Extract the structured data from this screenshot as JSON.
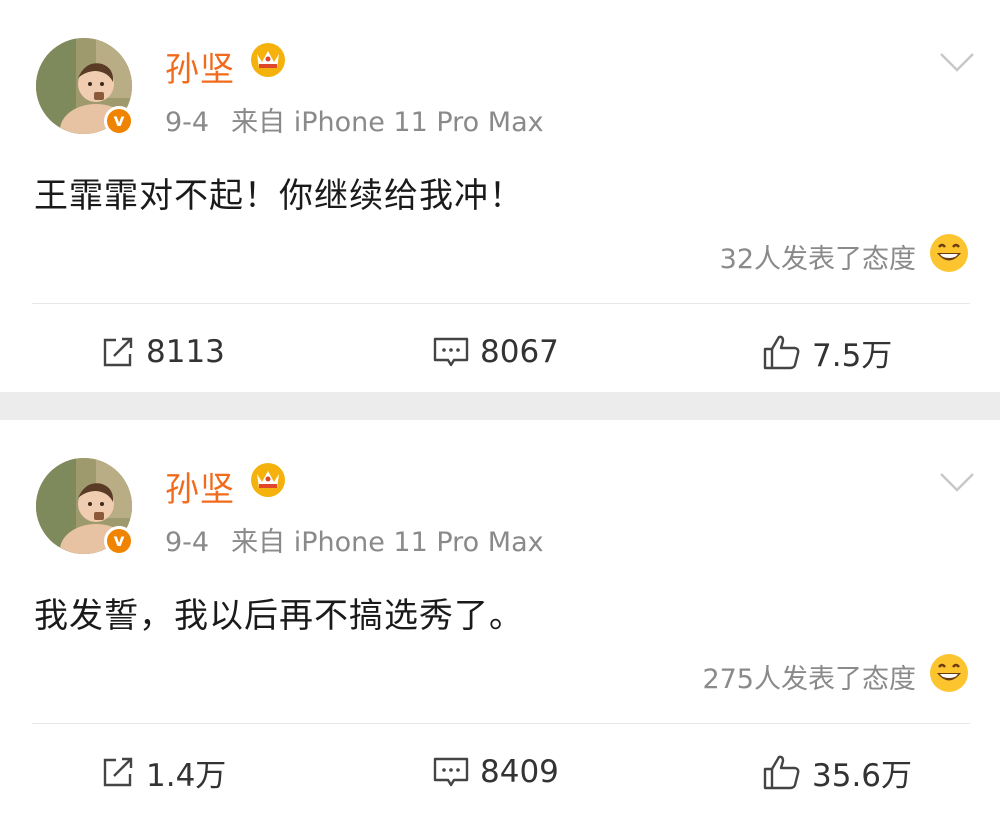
{
  "posts": [
    {
      "username": "孙坚",
      "date": "9-4",
      "source": "来自 iPhone 11 Pro Max",
      "content": "王霏霏对不起！你继续给我冲！",
      "attitude_text": "32人发表了态度",
      "reposts": "8113",
      "comments": "8067",
      "likes": "7.5万",
      "badge": "v"
    },
    {
      "username": "孙坚",
      "date": "9-4",
      "source": "来自 iPhone 11 Pro Max",
      "content": "我发誓，我以后再不搞选秀了。",
      "attitude_text": "275人发表了态度",
      "reposts": "1.4万",
      "comments": "8409",
      "likes": "35.6万",
      "badge": "v"
    }
  ],
  "colors": {
    "username": "#f26b1d",
    "badge": "#f08300",
    "separator": "#ececec",
    "meta_text": "#8a8a8a"
  },
  "icons": {
    "membership": "crown-icon",
    "dropdown": "chevron-down-icon",
    "attitude": "laughing-emoji-icon",
    "repost": "repost-icon",
    "comment": "comment-icon",
    "like": "thumbs-up-icon"
  }
}
